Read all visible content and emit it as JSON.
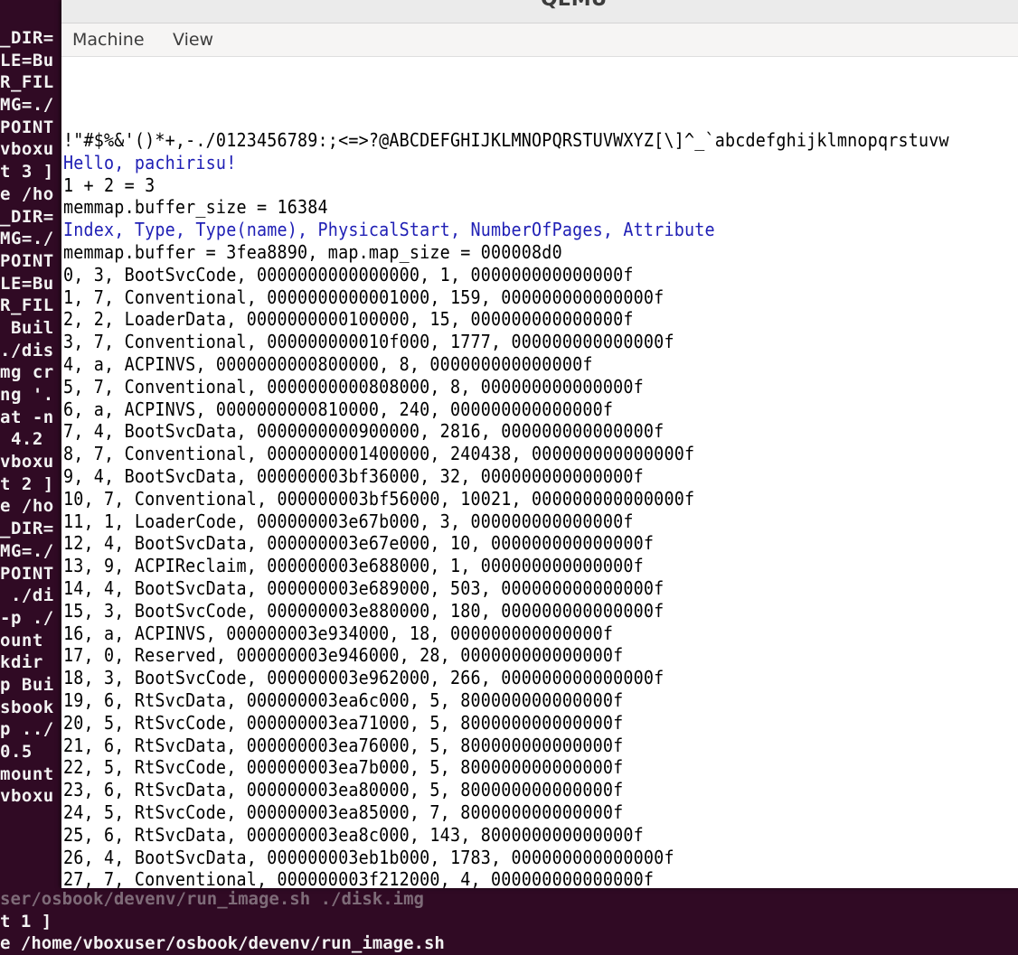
{
  "terminal": {
    "left_lines": [
      "_DIR=",
      "LE=Bu",
      "R_FIL",
      "MG=./",
      "POINT",
      "vboxu",
      "t 3 ]",
      "e /ho",
      "_DIR=",
      "MG=./",
      "POINT",
      "LE=Bu",
      "R_FIL",
      " Buil",
      "./dis",
      "mg cr",
      "ng '.",
      "at -n",
      " 4.2",
      "vboxu",
      "t 2 ]",
      "e /ho",
      "_DIR=",
      "MG=./",
      "POINT",
      " ./di",
      "-p ./",
      "ount ",
      "kdir ",
      "p Bui",
      "sbook",
      "p ../",
      "0.5",
      "mount",
      "vboxu"
    ],
    "bottom_lines": [
      "ser/osbook/devenv/run_image.sh ./disk.img",
      "t 1 ]",
      "e /home/vboxuser/osbook/devenv/run_image.sh"
    ]
  },
  "qemu": {
    "title": "QEMU",
    "menu": [
      "Machine",
      "View"
    ],
    "output": [
      {
        "text": "!\"#$%&'()*+,-./0123456789:;<=>?@ABCDEFGHIJKLMNOPQRSTUVWXYZ[\\]^_`abcdefghijklmnopqrstuvw",
        "color": "black"
      },
      {
        "text": "Hello, pachirisu!",
        "color": "blue"
      },
      {
        "text": "1 + 2 = 3",
        "color": "black"
      },
      {
        "text": "memmap.buffer_size = 16384",
        "color": "black"
      },
      {
        "text": "Index, Type, Type(name), PhysicalStart, NumberOfPages, Attribute",
        "color": "blue"
      },
      {
        "text": "memmap.buffer = 3fea8890, map.map_size = 000008d0",
        "color": "black"
      },
      {
        "text": "0, 3, BootSvcCode, 0000000000000000, 1, 000000000000000f",
        "color": "black"
      },
      {
        "text": "1, 7, Conventional, 0000000000001000, 159, 000000000000000f",
        "color": "black"
      },
      {
        "text": "2, 2, LoaderData, 0000000000100000, 15, 000000000000000f",
        "color": "black"
      },
      {
        "text": "3, 7, Conventional, 000000000010f000, 1777, 000000000000000f",
        "color": "black"
      },
      {
        "text": "4, a, ACPINVS, 0000000000800000, 8, 000000000000000f",
        "color": "black"
      },
      {
        "text": "5, 7, Conventional, 0000000000808000, 8, 000000000000000f",
        "color": "black"
      },
      {
        "text": "6, a, ACPINVS, 0000000000810000, 240, 000000000000000f",
        "color": "black"
      },
      {
        "text": "7, 4, BootSvcData, 0000000000900000, 2816, 000000000000000f",
        "color": "black"
      },
      {
        "text": "8, 7, Conventional, 0000000001400000, 240438, 000000000000000f",
        "color": "black"
      },
      {
        "text": "9, 4, BootSvcData, 000000003bf36000, 32, 000000000000000f",
        "color": "black"
      },
      {
        "text": "10, 7, Conventional, 000000003bf56000, 10021, 000000000000000f",
        "color": "black"
      },
      {
        "text": "11, 1, LoaderCode, 000000003e67b000, 3, 000000000000000f",
        "color": "black"
      },
      {
        "text": "12, 4, BootSvcData, 000000003e67e000, 10, 000000000000000f",
        "color": "black"
      },
      {
        "text": "13, 9, ACPIReclaim, 000000003e688000, 1, 000000000000000f",
        "color": "black"
      },
      {
        "text": "14, 4, BootSvcData, 000000003e689000, 503, 000000000000000f",
        "color": "black"
      },
      {
        "text": "15, 3, BootSvcCode, 000000003e880000, 180, 000000000000000f",
        "color": "black"
      },
      {
        "text": "16, a, ACPINVS, 000000003e934000, 18, 000000000000000f",
        "color": "black"
      },
      {
        "text": "17, 0, Reserved, 000000003e946000, 28, 000000000000000f",
        "color": "black"
      },
      {
        "text": "18, 3, BootSvcCode, 000000003e962000, 266, 000000000000000f",
        "color": "black"
      },
      {
        "text": "19, 6, RtSvcData, 000000003ea6c000, 5, 800000000000000f",
        "color": "black"
      },
      {
        "text": "20, 5, RtSvcCode, 000000003ea71000, 5, 800000000000000f",
        "color": "black"
      },
      {
        "text": "21, 6, RtSvcData, 000000003ea76000, 5, 800000000000000f",
        "color": "black"
      },
      {
        "text": "22, 5, RtSvcCode, 000000003ea7b000, 5, 800000000000000f",
        "color": "black"
      },
      {
        "text": "23, 6, RtSvcData, 000000003ea80000, 5, 800000000000000f",
        "color": "black"
      },
      {
        "text": "24, 5, RtSvcCode, 000000003ea85000, 7, 800000000000000f",
        "color": "black"
      },
      {
        "text": "25, 6, RtSvcData, 000000003ea8c000, 143, 800000000000000f",
        "color": "black"
      },
      {
        "text": "26, 4, BootSvcData, 000000003eb1b000, 1783, 000000000000000f",
        "color": "black"
      },
      {
        "text": "27, 7, Conventional, 000000003f212000, 4, 000000000000000f",
        "color": "black"
      }
    ]
  }
}
